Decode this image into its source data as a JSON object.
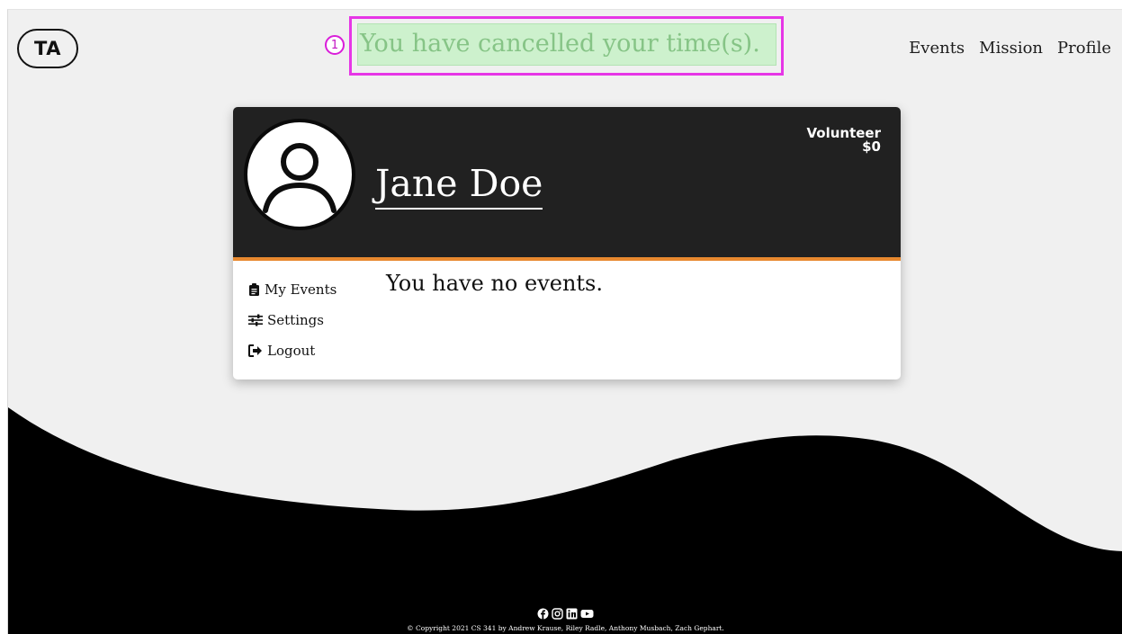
{
  "header": {
    "logo_text": "TA",
    "nav": [
      "Events",
      "Mission",
      "Profile"
    ]
  },
  "alert": {
    "badge": "1",
    "message": "You have cancelled your time(s)."
  },
  "profile": {
    "name": "Jane Doe",
    "role": "Volunteer",
    "amount": "$0",
    "menu": [
      {
        "label": "My Events",
        "icon": "clipboard-icon"
      },
      {
        "label": "Settings",
        "icon": "sliders-icon"
      },
      {
        "label": "Logout",
        "icon": "logout-icon"
      }
    ],
    "empty_message": "You have no events."
  },
  "footer": {
    "social_icons": [
      "facebook-icon",
      "instagram-icon",
      "linkedin-icon",
      "youtube-icon"
    ],
    "copyright": "© Copyright 2021 CS 341 by Andrew Krause, Riley Radle, Anthony Musbach, Zach Gephart."
  },
  "colors": {
    "alert_bg": "#cdf1cd",
    "alert_text": "#86c486",
    "highlight": "#e636e6",
    "accent": "#e8892f",
    "header_dark": "#212121"
  }
}
